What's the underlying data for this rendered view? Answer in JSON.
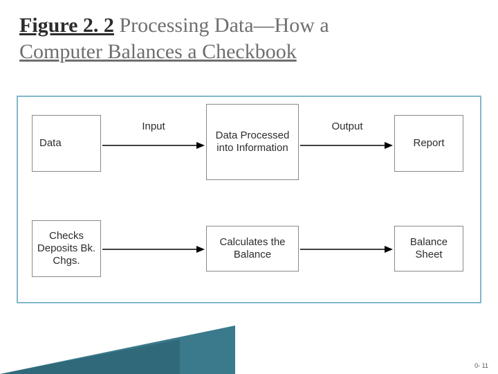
{
  "title": {
    "figure_prefix": "Figure 2. 2",
    "rest_line1": " Processing Data—How a",
    "line2": "Computer Balances a Checkbook"
  },
  "row1": {
    "boxes": {
      "b1": "Data",
      "b2": "Data Processed into Information",
      "b3": "Report"
    },
    "labels": {
      "l1": "Input",
      "l2": "Output"
    }
  },
  "row2": {
    "boxes": {
      "b1": "Checks Deposits Bk. Chgs.",
      "b2": "Calculates the Balance",
      "b3": "Balance Sheet"
    }
  },
  "page_number": "0-\n11"
}
